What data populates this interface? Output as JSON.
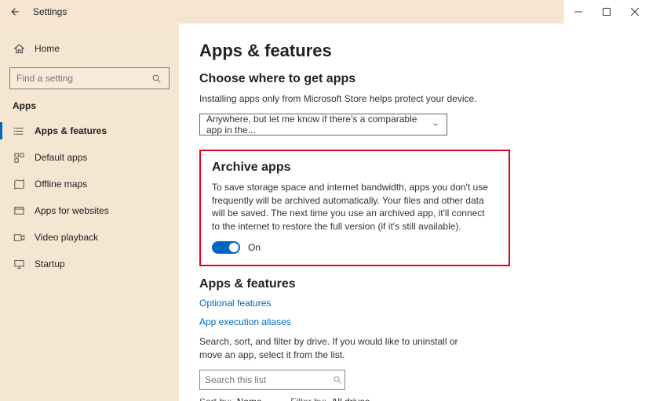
{
  "window": {
    "title": "Settings"
  },
  "sidebar": {
    "home": "Home",
    "search_placeholder": "Find a setting",
    "category": "Apps",
    "items": [
      {
        "label": "Apps & features"
      },
      {
        "label": "Default apps"
      },
      {
        "label": "Offline maps"
      },
      {
        "label": "Apps for websites"
      },
      {
        "label": "Video playback"
      },
      {
        "label": "Startup"
      }
    ]
  },
  "page": {
    "title": "Apps & features",
    "where_heading": "Choose where to get apps",
    "where_desc": "Installing apps only from Microsoft Store helps protect your device.",
    "where_value": "Anywhere, but let me know if there's a comparable app in the...",
    "archive_heading": "Archive apps",
    "archive_desc": "To save storage space and internet bandwidth, apps you don't use frequently will be archived automatically. Your files and other data will be saved. The next time you use an archived app, it'll connect to the internet to restore the full version (if it's still available).",
    "archive_toggle_label": "On",
    "af_heading": "Apps & features",
    "link_optional": "Optional features",
    "link_aliases": "App execution aliases",
    "af_desc": "Search, sort, and filter by drive. If you would like to uninstall or move an app, select it from the list.",
    "search_placeholder": "Search this list",
    "sort_label": "Sort by:",
    "sort_value": "Name",
    "filter_label": "Filter by:",
    "filter_value": "All drives"
  }
}
